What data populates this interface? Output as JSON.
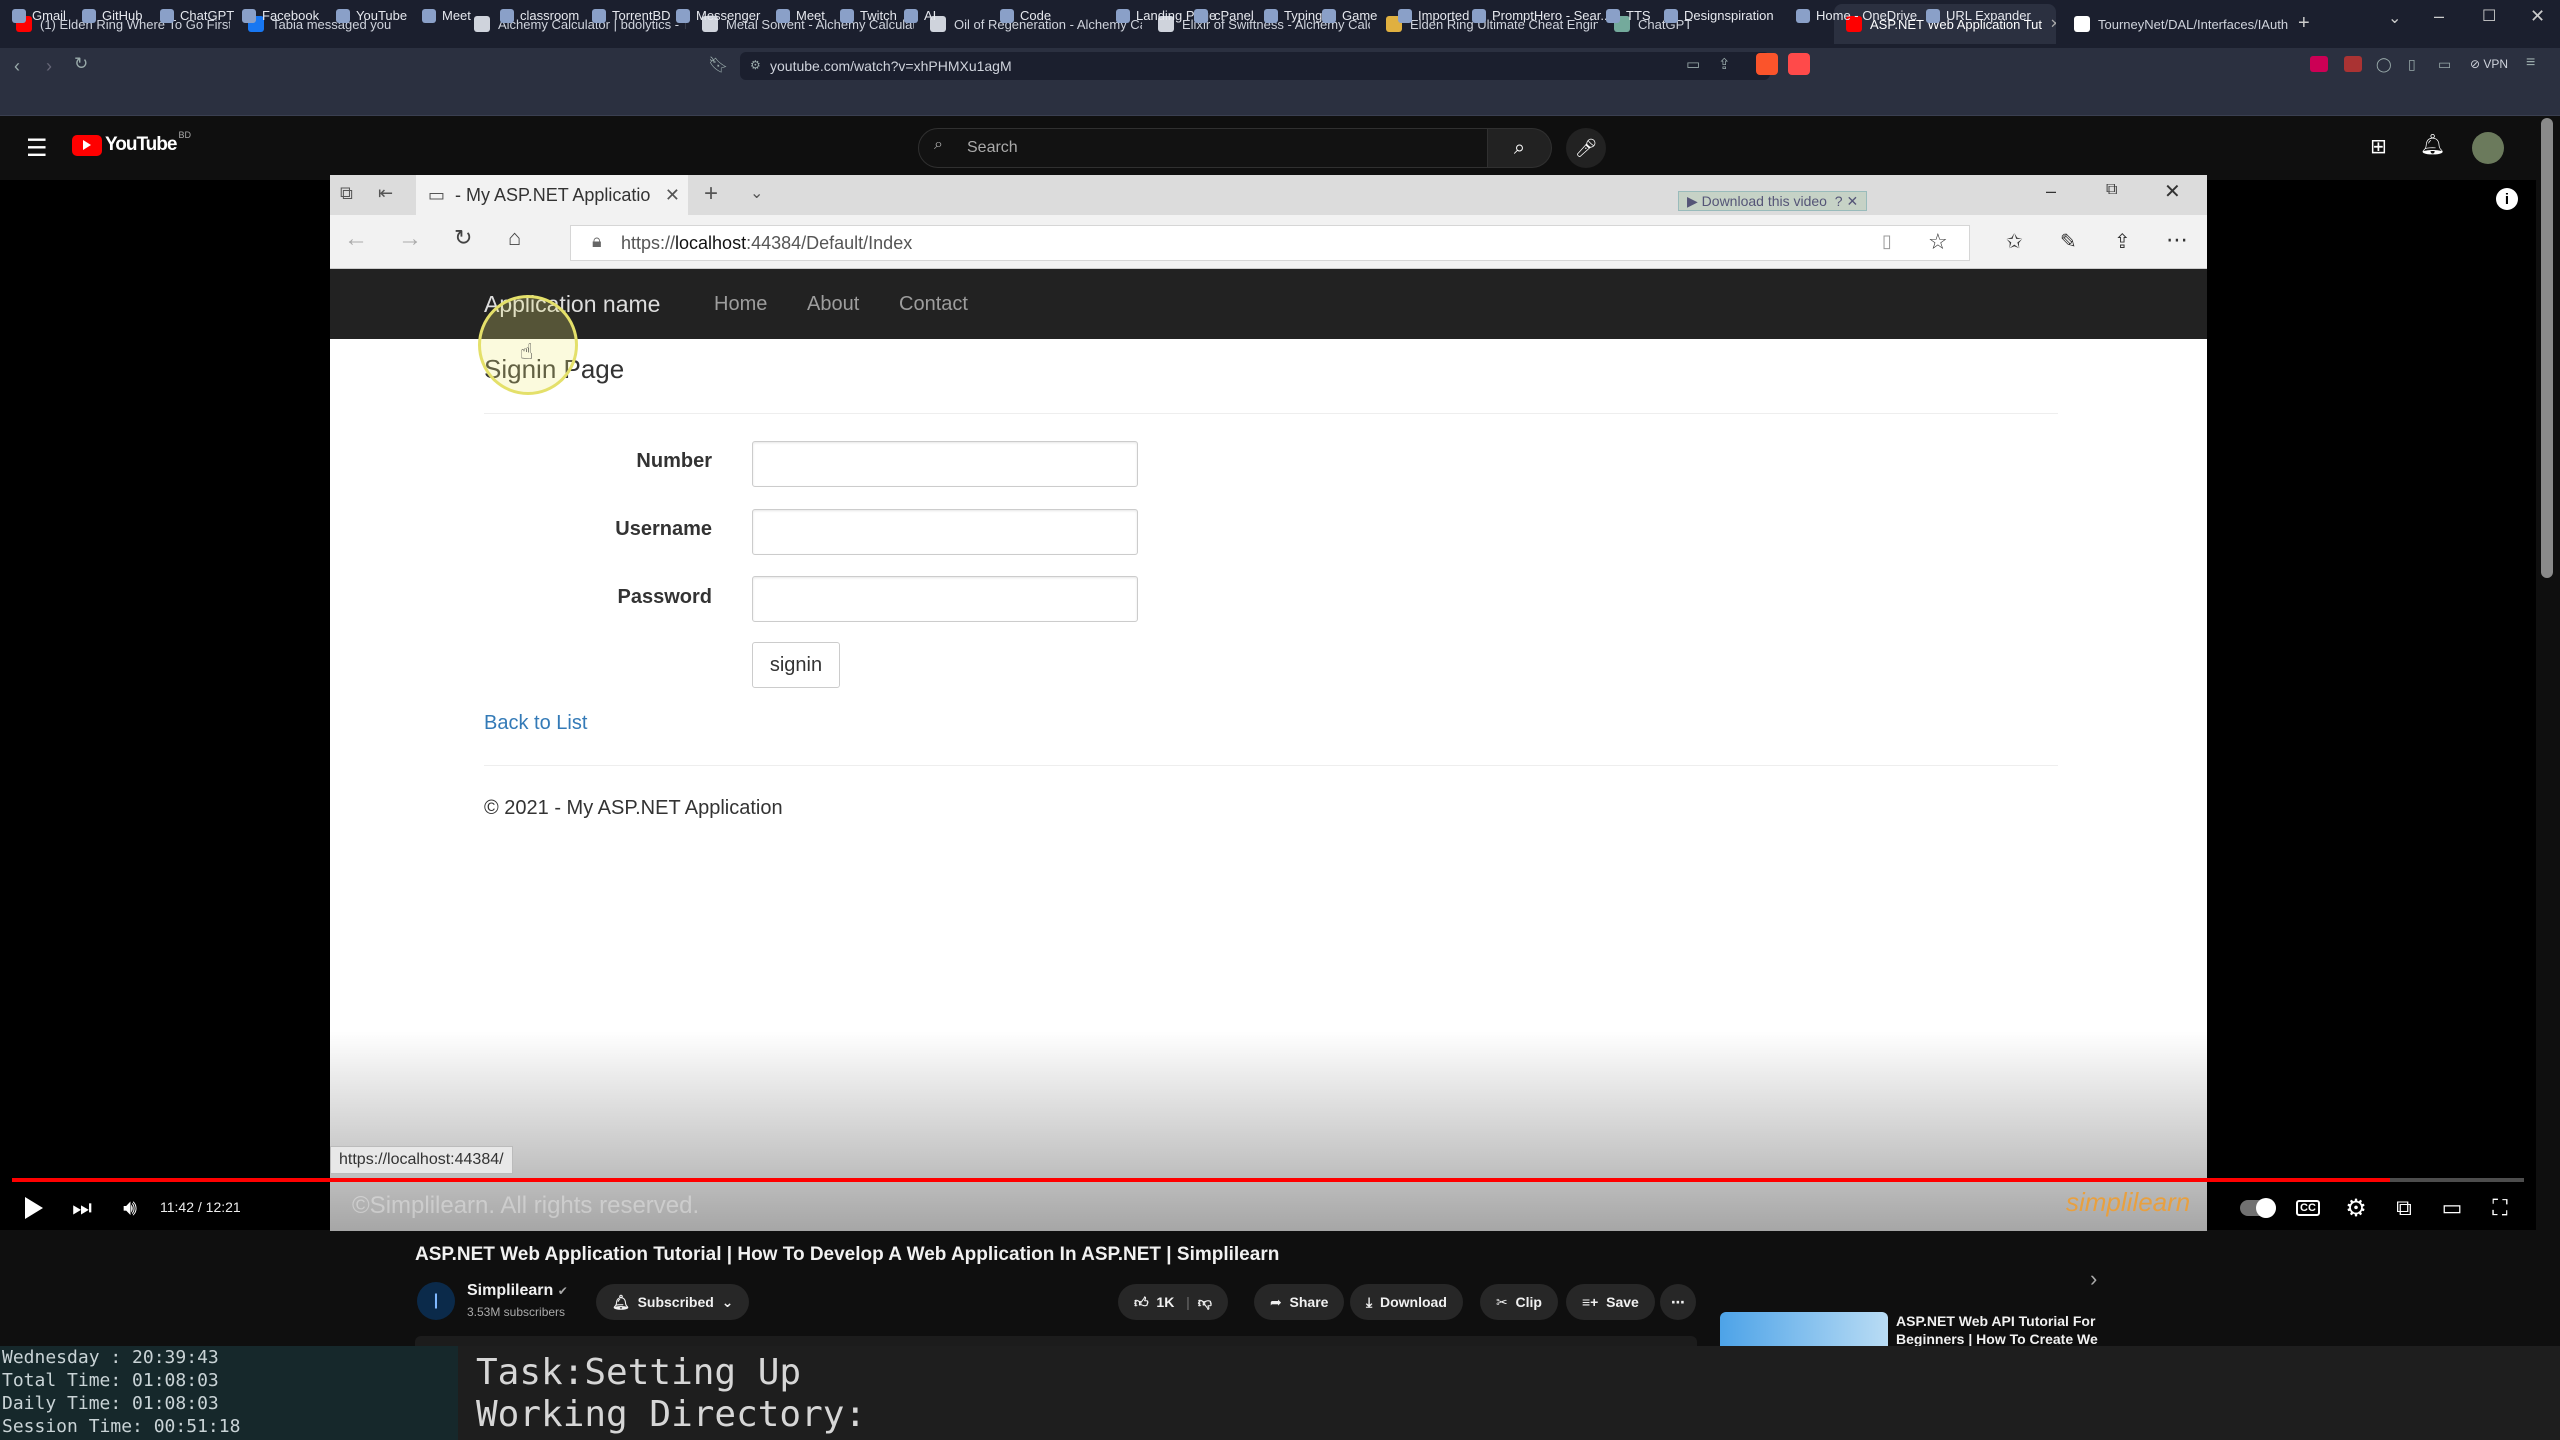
{
  "browser": {
    "tabs": [
      {
        "title": "(1) Elden Ring Where To Go First |",
        "color": "#ff0000"
      },
      {
        "title": "Tabia messaged you",
        "color": "#1877f2"
      },
      {
        "title": "Alchemy Calculator | bdolytics - Th",
        "color": "#cfd3dc"
      },
      {
        "title": "Metal Solvent - Alchemy Calculato",
        "color": "#cfd3dc"
      },
      {
        "title": "Oil of Regeneration - Alchemy Calc",
        "color": "#cfd3dc"
      },
      {
        "title": "Elixir of Swiftness - Alchemy Calcul",
        "color": "#cfd3dc"
      },
      {
        "title": "Elden Ring Ultimate Cheat Engine",
        "color": "#e0b040"
      },
      {
        "title": "ChatGPT",
        "color": "#74aa9c"
      },
      {
        "title": "ASP.NET Web Application Tut",
        "color": "#ff0000"
      },
      {
        "title": "TourneyNet/DAL/Interfaces/IAuth",
        "color": "#ffffff"
      }
    ],
    "new_tab": "+",
    "url": "youtube.com/watch?v=xhPHMXu1agM",
    "vpn_label": "VPN",
    "bookmarks": [
      "Gmail",
      "GitHub",
      "ChatGPT",
      "Facebook",
      "YouTube",
      "Meet",
      "classroom",
      "TorrentBD",
      "Messenger",
      "Meet",
      "Twitch",
      "AI",
      "Code",
      "Landing Page",
      "cPanel",
      "Typing",
      "Game",
      "Imported",
      "PromptHero - Sear...",
      "TTS",
      "Designspiration",
      "Home - OneDrive",
      "URL Expander"
    ]
  },
  "youtube": {
    "logo": "YouTube",
    "logo_region": "BD",
    "search_placeholder": "Search"
  },
  "video": {
    "inner_tab_title": "- My ASP.NET Applicatio",
    "download_overlay": "Download this video",
    "inner_url_prefix": "https://",
    "inner_url_host": "localhost",
    "inner_url_rest": ":44384/Default/Index",
    "app_name": "Application name",
    "nav": [
      "Home",
      "About",
      "Contact"
    ],
    "page_heading": "Signin Page",
    "fields": [
      {
        "label": "Number"
      },
      {
        "label": "Username"
      },
      {
        "label": "Password"
      }
    ],
    "signin_label": "signin",
    "back_link": "Back to List",
    "footer": "© 2021 - My ASP.NET Application",
    "status_url": "https://localhost:44384/",
    "watermark": "©Simplilearn. All rights reserved.",
    "brand": "simplilearn"
  },
  "player": {
    "time": "11:42 / 12:21",
    "progress": 0.9468
  },
  "meta": {
    "title": "ASP.NET Web Application Tutorial | How To Develop A Web Application In ASP.NET | Simplilearn",
    "channel": "Simplilearn",
    "subscribers": "3.53M subscribers",
    "subscribed_label": "Subscribed",
    "likes": "1K",
    "share": "Share",
    "download": "Download",
    "clip": "Clip",
    "save": "Save",
    "next_title_1": "ASP.NET Web API Tutorial For",
    "next_title_2": "Beginners | How To Create We"
  },
  "terminal": {
    "left_lines": [
      "Wednesday  :  20:39:43",
      "Total Time: 01:08:03",
      "Daily Time: 01:08:03",
      "Session Time: 00:51:18"
    ],
    "task": "Task:Setting Up",
    "dir": "Working Directory:"
  }
}
